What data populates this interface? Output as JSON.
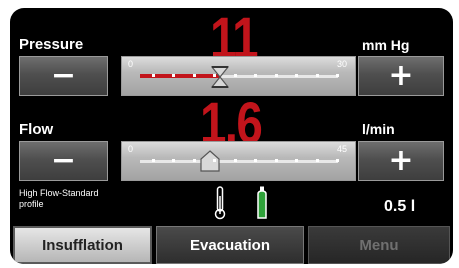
{
  "pressure": {
    "label": "Pressure",
    "value": "11",
    "unit": "mm Hg",
    "scale_min": "0",
    "scale_max": "30",
    "setpoint": 11,
    "minus_symbol": "−",
    "plus_symbol": "+"
  },
  "flow": {
    "label": "Flow",
    "value": "1.6",
    "unit": "l/min",
    "scale_min": "0",
    "scale_max": "45",
    "setpoint": 1.6,
    "minus_symbol": "−",
    "plus_symbol": "+"
  },
  "profile": {
    "line1": "High Flow-Standard",
    "line2": "profile"
  },
  "volume": "0.5 l",
  "tabs": [
    {
      "label": "Insufflation",
      "active": true
    },
    {
      "label": "Evacuation",
      "active": false
    },
    {
      "label": "Menu",
      "active": false,
      "disabled": true
    }
  ],
  "colors": {
    "value_red": "#c2141b",
    "gas_green": "#2fa23a"
  }
}
